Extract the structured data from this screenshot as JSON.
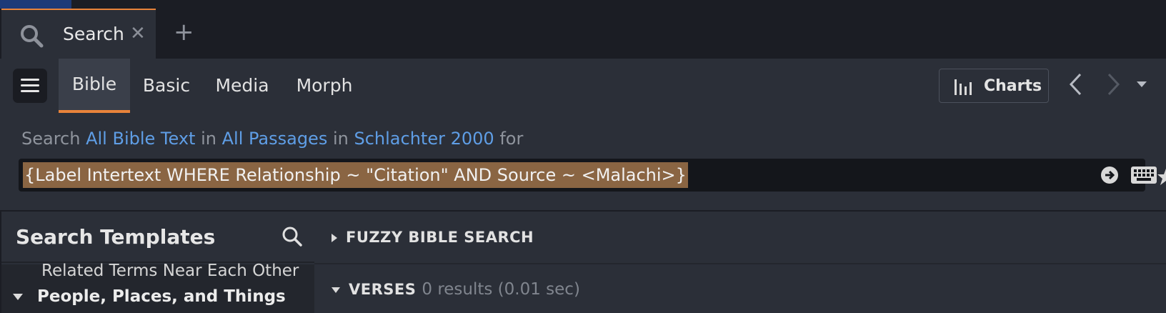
{
  "tab": {
    "label": "Search",
    "close": "✕",
    "new": "+"
  },
  "toolbar": {
    "subtabs": [
      "Bible",
      "Basic",
      "Media",
      "Morph"
    ],
    "active_subtab": "Bible",
    "charts_label": "Charts"
  },
  "search": {
    "prefix": "Search",
    "scope": "All Bible Text",
    "in1": "in",
    "range": "All Passages",
    "in2": "in",
    "resource": "Schlachter 2000",
    "for": "for",
    "query": "{Label Intertext WHERE Relationship ~ \"Citation\" AND Source ~ <Malachi>}"
  },
  "sidebar": {
    "title": "Search Templates",
    "item_partial": "Related Terms Near Each Other",
    "group": "People, Places, and Things"
  },
  "results": {
    "fuzzy_label": "FUZZY BIBLE SEARCH",
    "verses_label": "VERSES",
    "verses_count": "0 results (0.01 sec)"
  },
  "colors": {
    "accent": "#e8833a",
    "link": "#5f9ee6",
    "highlight": "#8a6543"
  }
}
